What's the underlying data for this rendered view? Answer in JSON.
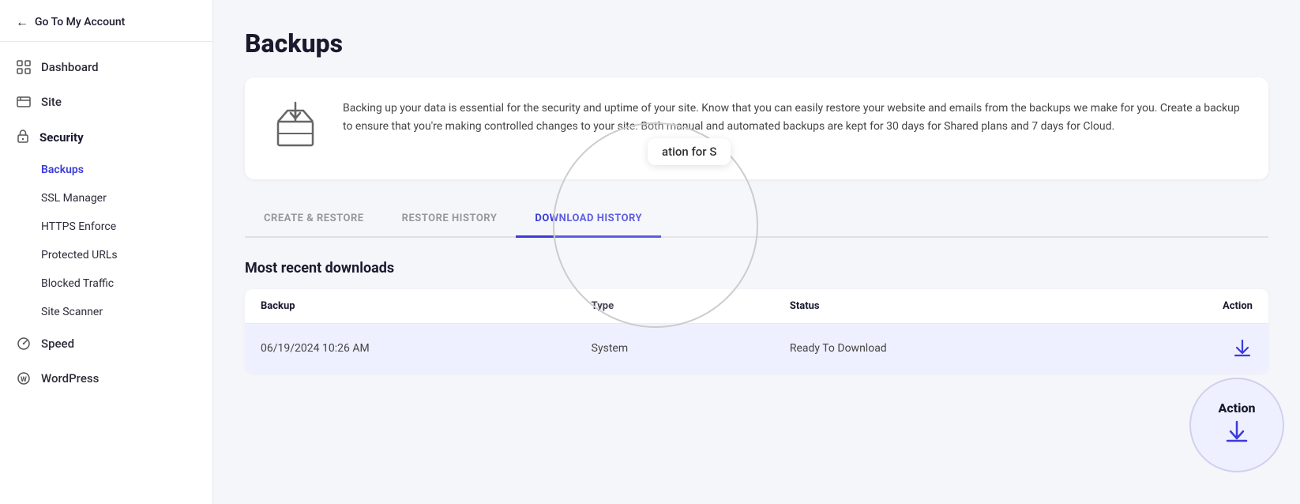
{
  "sidebar": {
    "back_label": "Go To My Account",
    "nav_items": [
      {
        "id": "dashboard",
        "label": "Dashboard",
        "icon": "grid"
      },
      {
        "id": "site",
        "label": "Site",
        "icon": "site"
      },
      {
        "id": "security",
        "label": "Security",
        "icon": "lock"
      },
      {
        "id": "speed",
        "label": "Speed",
        "icon": "speed"
      },
      {
        "id": "wordpress",
        "label": "WordPress",
        "icon": "wp"
      }
    ],
    "security_sub_items": [
      {
        "id": "backups",
        "label": "Backups",
        "active": true
      },
      {
        "id": "ssl-manager",
        "label": "SSL Manager",
        "active": false
      },
      {
        "id": "https-enforce",
        "label": "HTTPS Enforce",
        "active": false
      },
      {
        "id": "protected-urls",
        "label": "Protected URLs",
        "active": false
      },
      {
        "id": "blocked-traffic",
        "label": "Blocked Traffic",
        "active": false
      },
      {
        "id": "site-scanner",
        "label": "Site Scanner",
        "active": false
      }
    ]
  },
  "main": {
    "page_title": "Backups",
    "info_text": "Backing up your data is essential for the security and uptime of your site. Know that you can easily restore your website and emails from the backups we make for you. Create a backup to ensure that you're making controlled changes to your site. Both manual and automated backups are kept for 30 days for Shared plans and 7 days for Cloud.",
    "tabs": [
      {
        "id": "create-restore",
        "label": "CREATE & RESTORE",
        "active": false
      },
      {
        "id": "restore-history",
        "label": "RESTORE HISTORY",
        "active": false
      },
      {
        "id": "download-history",
        "label": "DOWNLOAD HISTORY",
        "active": true
      }
    ],
    "section_title": "Most recent downloads",
    "table_headers": [
      "Backup",
      "Type",
      "Status",
      "Action"
    ],
    "table_rows": [
      {
        "date": "06/19/2024",
        "time": "10:26 AM",
        "type": "System",
        "status": "Ready To Download"
      }
    ],
    "circle_tooltip": "ation for S",
    "action_label": "Action"
  }
}
